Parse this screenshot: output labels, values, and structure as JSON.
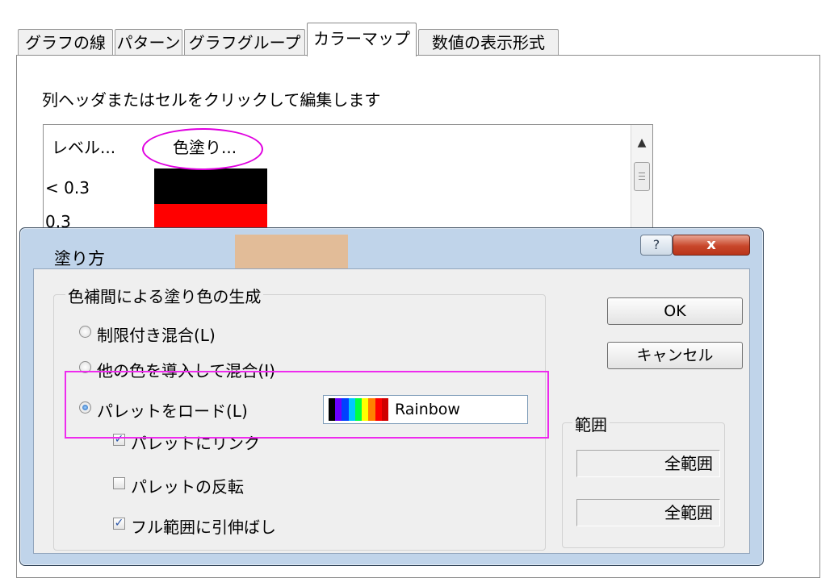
{
  "tabs": [
    {
      "label": "グラフの線"
    },
    {
      "label": "パターン"
    },
    {
      "label": "グラフグループ"
    },
    {
      "label": "カラーマップ",
      "active": true
    },
    {
      "label": "数値の表示形式"
    }
  ],
  "instruction": "列ヘッダまたはセルをクリックして編集します",
  "grid": {
    "columns": [
      "レベル...",
      "色塗り..."
    ],
    "rows": [
      {
        "level": "< 0.3",
        "color": "#000000"
      },
      {
        "level": "0.3",
        "color": "#ff0000"
      },
      {
        "level": "",
        "color": "#e8b78a"
      }
    ]
  },
  "dialog": {
    "title": "塗り方",
    "help_label": "?",
    "close_label": "x",
    "group_title": "色補間による塗り色の生成",
    "options": [
      {
        "label": "制限付き混合(L)",
        "checked": false
      },
      {
        "label": "他の色を導入して混合(I)",
        "checked": false
      },
      {
        "label": "パレットをロード(L)",
        "checked": true
      }
    ],
    "palette": {
      "name": "Rainbow",
      "colors": [
        "#000000",
        "#6a00ff",
        "#0040ff",
        "#00c8ff",
        "#00ff40",
        "#ffff00",
        "#ff8000",
        "#ff0000",
        "#d00000"
      ]
    },
    "checkboxes": [
      {
        "label": "パレットにリンク",
        "checked": true,
        "mark": "✓"
      },
      {
        "label": "パレットの反転",
        "checked": false,
        "mark": ""
      },
      {
        "label": "フル範囲に引伸ばし",
        "checked": true,
        "mark": "✓"
      }
    ],
    "ok_label": "OK",
    "cancel_label": "キャンセル",
    "range": {
      "title": "範囲",
      "from": "全範囲",
      "to": "全範囲"
    }
  },
  "colors": {
    "highlight": "#ee2bee",
    "dialog_frame": "#c0d4ea",
    "close_button": "#c8472b"
  }
}
